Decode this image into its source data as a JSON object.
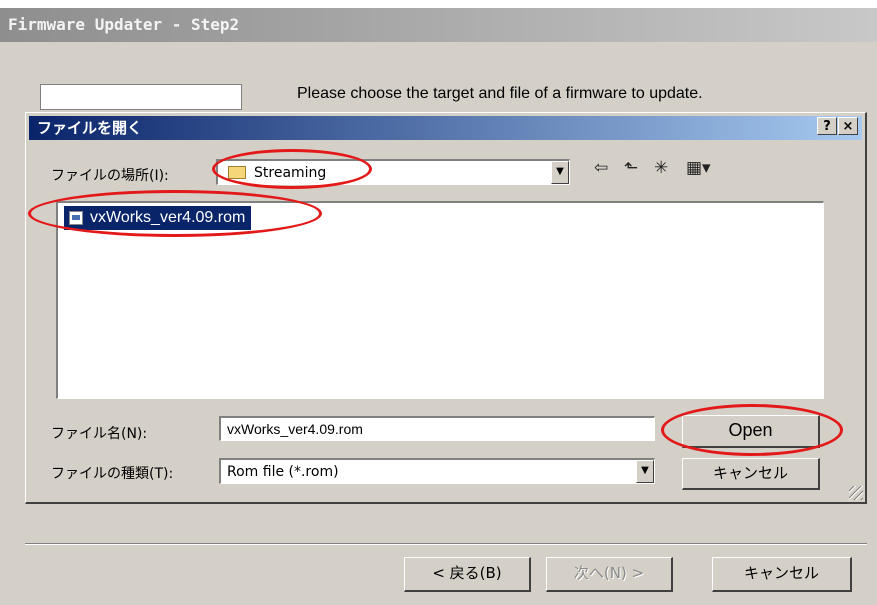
{
  "window": {
    "title": "Firmware Updater - Step2"
  },
  "main": {
    "instruction": "Please choose the target and file of a firmware to update."
  },
  "dialog": {
    "title": "ファイルを開く",
    "help_button": "?",
    "close_button": "×",
    "look_in_label": "ファイルの場所(I):",
    "look_in_value": "Streaming",
    "files": [
      {
        "name": "vxWorks_ver4.09.rom",
        "selected": true
      }
    ],
    "filename_label": "ファイル名(N):",
    "filename_value": "vxWorks_ver4.09.rom",
    "filetype_label": "ファイルの種類(T):",
    "filetype_value": "Rom file (*.rom)",
    "open_button": "Open",
    "cancel_button": "キャンセル",
    "toolbar_icons": [
      "back-arrow-icon",
      "up-folder-icon",
      "new-folder-icon",
      "view-menu-icon"
    ]
  },
  "wizard": {
    "back_button": "< 戻る(B)",
    "next_button": "次へ(N) >",
    "cancel_button": "キャンセル"
  },
  "highlight_color": "#e31818",
  "selection_color": "#0a246a"
}
